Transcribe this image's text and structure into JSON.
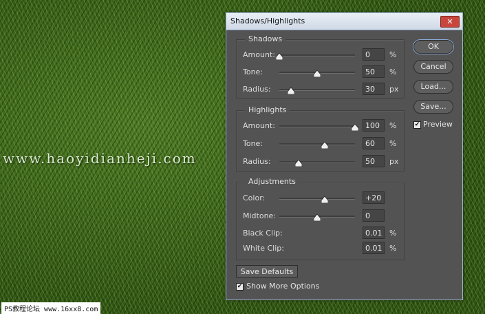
{
  "background": {
    "watermark_text": "www.haoyidianheji.com",
    "footer_mark": "PS教程论坛 www.16xx8.com"
  },
  "dialog": {
    "title": "Shadows/Highlights",
    "close_glyph": "✕",
    "buttons": {
      "ok": "OK",
      "cancel": "Cancel",
      "load": "Load...",
      "save": "Save..."
    },
    "preview": {
      "label": "Preview",
      "checked": true
    },
    "save_defaults": "Save Defaults",
    "show_more": {
      "label": "Show More Options",
      "checked": true
    },
    "check_glyph": "✔",
    "sections": [
      {
        "title": "Shadows",
        "rows": [
          {
            "label": "Amount:",
            "value": "0",
            "unit": "%",
            "slider_fraction": 0.0
          },
          {
            "label": "Tone:",
            "value": "50",
            "unit": "%",
            "slider_fraction": 0.5
          },
          {
            "label": "Radius:",
            "value": "30",
            "unit": "px",
            "slider_fraction": 0.15
          }
        ]
      },
      {
        "title": "Highlights",
        "rows": [
          {
            "label": "Amount:",
            "value": "100",
            "unit": "%",
            "slider_fraction": 1.0
          },
          {
            "label": "Tone:",
            "value": "60",
            "unit": "%",
            "slider_fraction": 0.6
          },
          {
            "label": "Radius:",
            "value": "50",
            "unit": "px",
            "slider_fraction": 0.25
          }
        ]
      },
      {
        "title": "Adjustments",
        "rows": [
          {
            "label": "Color:",
            "value": "+20",
            "unit": "",
            "slider_fraction": 0.6
          },
          {
            "label": "Midtone:",
            "value": "0",
            "unit": "",
            "slider_fraction": 0.5
          },
          {
            "label": "Black Clip:",
            "value": "0.01",
            "unit": "%"
          },
          {
            "label": "White Clip:",
            "value": "0.01",
            "unit": "%"
          }
        ]
      }
    ]
  }
}
